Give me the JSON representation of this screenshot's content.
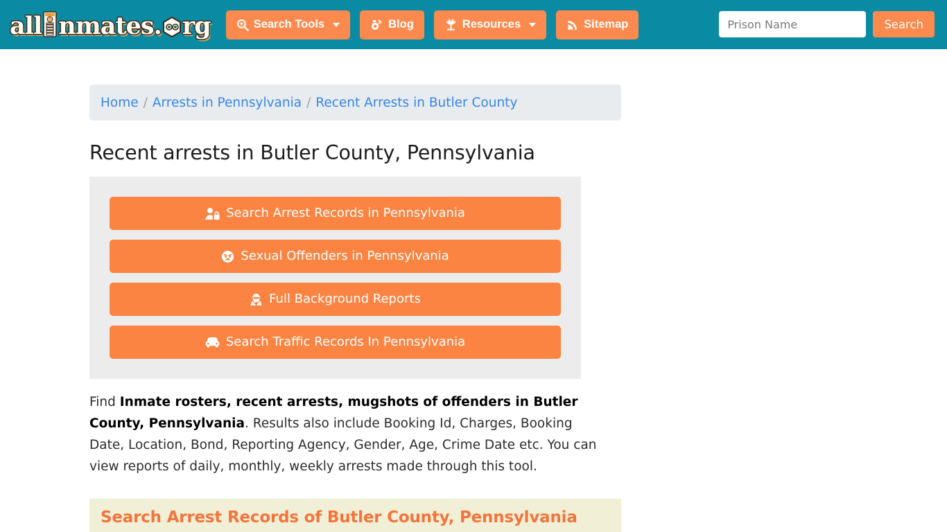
{
  "header": {
    "logo": {
      "part1": "all",
      "part2": "nmates",
      "part3": ".",
      "part4": "rg",
      "alt": "allInmates.org"
    },
    "nav": [
      {
        "label": "Search Tools",
        "icon": "search-plus-icon",
        "has_caret": true
      },
      {
        "label": "Blog",
        "icon": "blogger-icon",
        "has_caret": false
      },
      {
        "label": "Resources",
        "icon": "leaf-seedling-icon",
        "has_caret": true
      },
      {
        "label": "Sitemap",
        "icon": "rss-sitemap-icon",
        "has_caret": false
      }
    ],
    "search": {
      "placeholder": "Prison Name",
      "value": "",
      "button_label": "Search"
    },
    "colors": {
      "bar_background": "#0a8ba3",
      "button_background": "#fc8a4e"
    }
  },
  "breadcrumb": {
    "items": [
      "Home",
      "Arrests in Pennsylvania",
      "Recent Arrests in Butler County"
    ],
    "separator": "/"
  },
  "main": {
    "title": "Recent arrests in Butler County, Pennsylvania",
    "action_buttons": [
      {
        "label": "Search Arrest Records in Pennsylvania",
        "icon": "user-lock-icon"
      },
      {
        "label": "Sexual Offenders in Pennsylvania",
        "icon": "angry-face-icon"
      },
      {
        "label": "Full Background Reports",
        "icon": "user-secret-icon"
      },
      {
        "label": "Search Traffic Records In Pennsylvania",
        "icon": "car-icon"
      }
    ],
    "paragraph": {
      "lead": "Find ",
      "bold": "Inmate rosters, recent arrests, mugshots of offenders in Butler County, Pennsylvania",
      "rest": ". Results also include Booking Id, Charges, Booking Date, Location, Bond, Reporting Agency, Gender, Age, Crime Date etc. You can view reports of daily, monthly, weekly arrests made through this tool."
    },
    "section_heading": "Search Arrest Records of Butler County, Pennsylvania",
    "colors": {
      "panel_background": "#ececec",
      "button_background": "#fc8442",
      "section_background": "#f1f0d7",
      "section_text": "#f4743b",
      "link": "#3586e8"
    }
  }
}
